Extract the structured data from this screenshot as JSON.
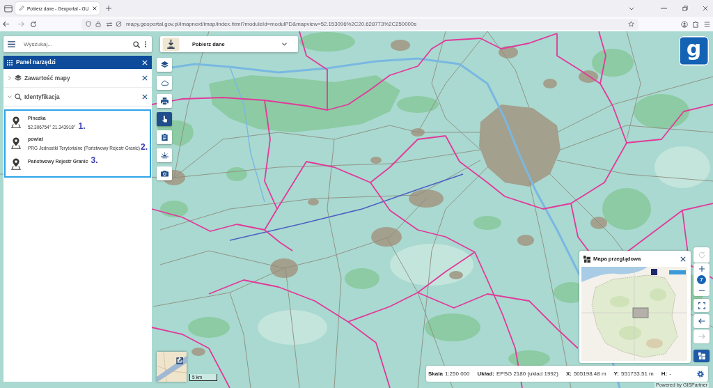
{
  "browser": {
    "tabs": [
      {
        "title": "Pobierz dane - Geoportal - GU",
        "selected": true
      }
    ],
    "url": "mapy.geoportal.gov.pl/imapnext/imap/index.html?moduleId=modulPD&mapview=52.153096%2C20.628773%2C250000s"
  },
  "search": {
    "placeholder": "Wyszukaj..."
  },
  "tool_panel": {
    "title": "Panel narzędzi",
    "sections": [
      {
        "title": "Zawartość mapy",
        "kind": "layers",
        "expanded": false
      },
      {
        "title": "Identyfikacja",
        "kind": "search",
        "expanded": true
      }
    ]
  },
  "results": [
    {
      "title": "Pinezka",
      "subtitle": "52.306754° 21.343918°",
      "marker": "1."
    },
    {
      "title": "powiat",
      "subtitle": "PRG Jednostki Terytorialne (Państwowy Rejestr Granic)",
      "marker": "2."
    },
    {
      "title": "Państwowy Rejestr Granic",
      "marker": "3."
    }
  ],
  "download": {
    "label": "Pobierz dane"
  },
  "toolbar": [
    {
      "kind": "layers",
      "selected": false
    },
    {
      "kind": "cloud",
      "selected": false
    },
    {
      "kind": "print",
      "selected": false
    },
    {
      "kind": "touch",
      "selected": true
    },
    {
      "kind": "clipboard",
      "selected": false
    },
    {
      "kind": "horizon",
      "selected": false
    },
    {
      "kind": "camera",
      "selected": false
    }
  ],
  "logo": {
    "mark": "g"
  },
  "map_controls": [
    {
      "kind": "refresh",
      "disabled": true
    },
    {
      "kind": "zoom",
      "value": "7"
    },
    {
      "kind": "fullscreen",
      "disabled": false
    },
    {
      "kind": "back",
      "disabled": false
    },
    {
      "kind": "forward",
      "disabled": true
    },
    {
      "kind": "overview",
      "selected": true
    }
  ],
  "overview": {
    "title": "Mapa przeglądowa"
  },
  "status_bar": [
    {
      "label": "Skala",
      "value": "1:250 000"
    },
    {
      "label": "Układ:",
      "value": "EPSG 2180 (układ 1992)"
    },
    {
      "label": "X:",
      "value": "505198.48 m"
    },
    {
      "label": "Y:",
      "value": "551733.51 m"
    },
    {
      "label": "H:",
      "value": "-"
    }
  ],
  "scale_bar": {
    "label": "5 km"
  },
  "credit": "Powered by GISPartner"
}
